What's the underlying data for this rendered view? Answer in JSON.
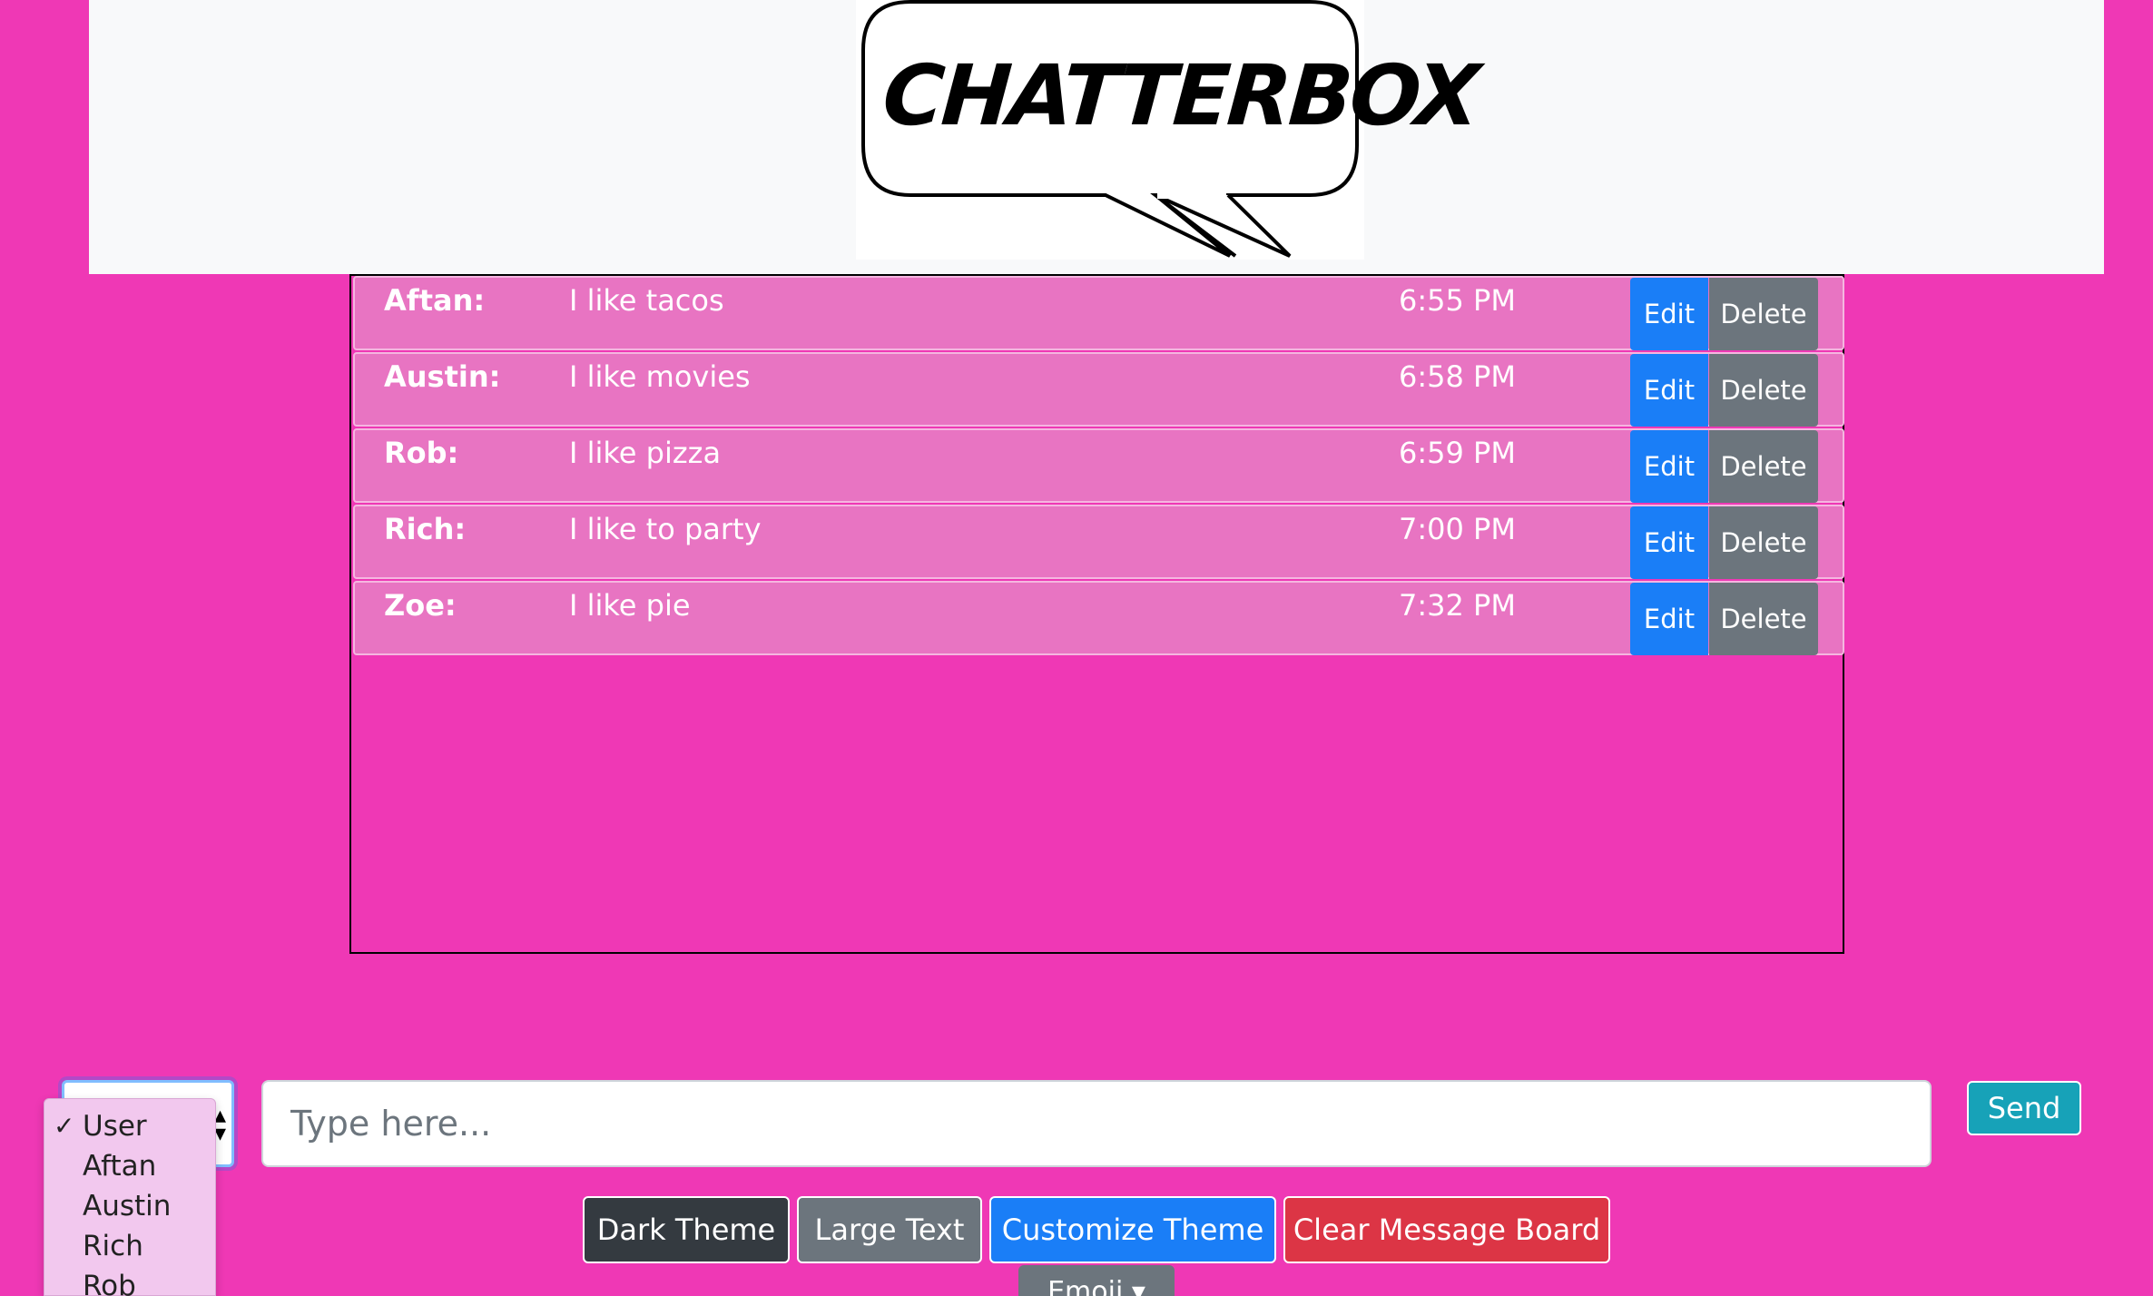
{
  "header": {
    "logo_text": "CHATTERBOX"
  },
  "messages": [
    {
      "user": "Aftan:",
      "text": "I like tacos",
      "time": "6:55 PM",
      "edit_label": "Edit",
      "delete_label": "Delete"
    },
    {
      "user": "Austin:",
      "text": "I like movies",
      "time": "6:58 PM",
      "edit_label": "Edit",
      "delete_label": "Delete"
    },
    {
      "user": "Rob:",
      "text": "I like pizza",
      "time": "6:59 PM",
      "edit_label": "Edit",
      "delete_label": "Delete"
    },
    {
      "user": "Rich:",
      "text": "I like to party",
      "time": "7:00 PM",
      "edit_label": "Edit",
      "delete_label": "Delete"
    },
    {
      "user": "Zoe:",
      "text": "I like pie",
      "time": "7:32 PM",
      "edit_label": "Edit",
      "delete_label": "Delete"
    }
  ],
  "user_select": {
    "selected": "User",
    "options": [
      "User",
      "Aftan",
      "Austin",
      "Rich",
      "Rob"
    ],
    "check_glyph": "✓"
  },
  "compose": {
    "placeholder": "Type here...",
    "send_label": "Send"
  },
  "theme_buttons": {
    "dark_theme": "Dark Theme",
    "large_text": "Large Text",
    "customize_theme": "Customize Theme",
    "clear_board": "Clear Message Board",
    "emoji": "Emoji ▾"
  },
  "colors": {
    "background": "#ef38b5",
    "message_row": "#e874c2",
    "edit_button": "#1a7ef7",
    "delete_button": "#6c757d",
    "send_button": "#17a2b8",
    "dark_theme_button": "#343a40",
    "large_text_button": "#6c757d",
    "customize_button": "#1a7ef7",
    "clear_button": "#dc3545"
  }
}
